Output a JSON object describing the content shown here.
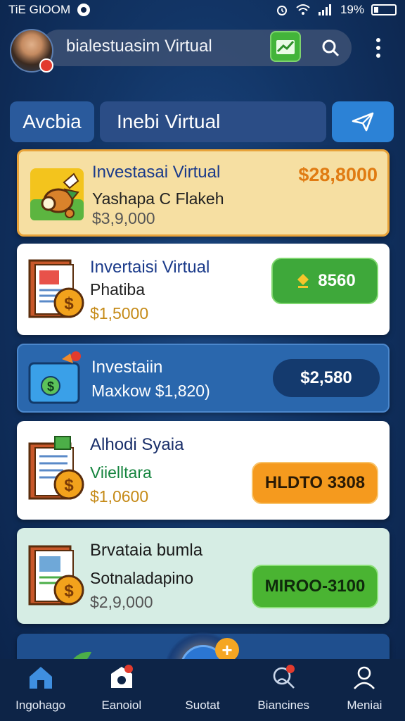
{
  "status_bar": {
    "left_text": "TiE GIOOM",
    "battery_percent": "19%"
  },
  "header": {
    "title": "bialestuasim Virtual"
  },
  "tabs": {
    "tab_a": "Avcbia",
    "tab_b": "Inebi Virtual"
  },
  "cards": [
    {
      "title": "Investasai Virtual",
      "subtitle": "Yashapa C Flakeh",
      "amount": "$3,9,000",
      "price": "$28,8000"
    },
    {
      "title": "Invertaisi Virtual",
      "subtitle": "Phatiba",
      "amount": "$1,5000",
      "button": "8560"
    },
    {
      "title": "Investaiin",
      "subtitle": "Maxkow $1,820)",
      "button": "$2,580"
    },
    {
      "title": "Alhodi Syaia",
      "subtitle": "Viielltara",
      "amount": "$1,0600",
      "button": "HLDTO 3308"
    },
    {
      "title": "Brvataia bumla",
      "subtitle": "Sotnaladapino",
      "amount": "$2,9,000",
      "button": "MIROO-3100"
    }
  ],
  "bottom_nav": [
    {
      "label": "Ingohago",
      "icon": "home-icon"
    },
    {
      "label": "Eanoiol",
      "icon": "camera-icon"
    },
    {
      "label": "Suotat",
      "icon": "tag-icon"
    },
    {
      "label": "Biancines",
      "icon": "person-search-icon"
    },
    {
      "label": "Meniai",
      "icon": "profile-icon"
    }
  ],
  "colors": {
    "accent_blue": "#2c82d6",
    "card_gold": "#f6dfa2",
    "green_button": "#43b43a",
    "orange_button": "#f59a1e"
  }
}
